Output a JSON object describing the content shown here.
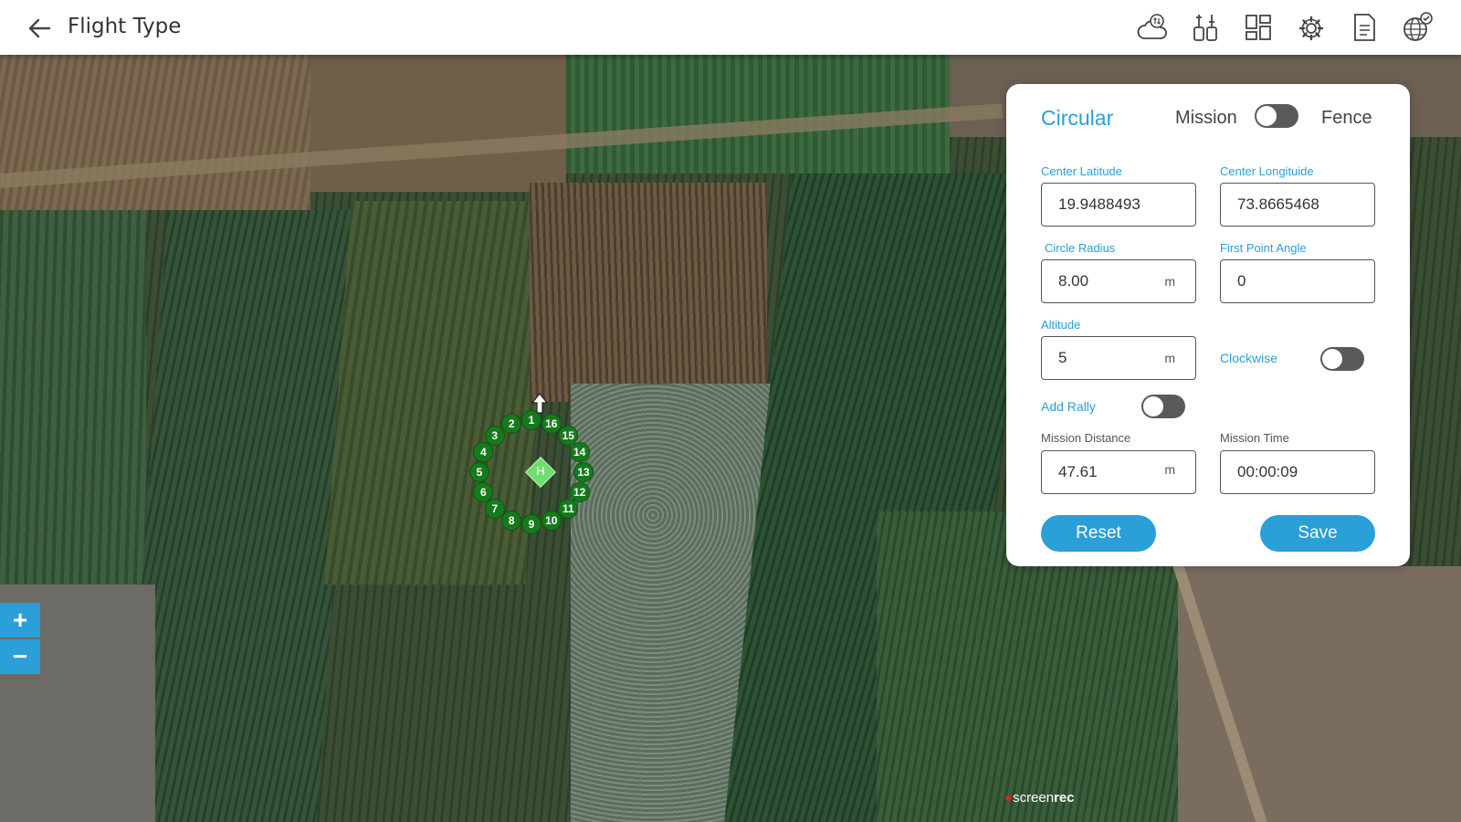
{
  "header": {
    "title": "Flight Type",
    "toolbar_icons": [
      "cloud-sync-icon",
      "controller-sliders-icon",
      "layout-dashboard-icon",
      "settings-gear-icon",
      "document-icon",
      "globe-check-icon"
    ]
  },
  "map": {
    "home_label": "H",
    "waypoints": [
      "1",
      "2",
      "3",
      "4",
      "5",
      "6",
      "7",
      "8",
      "9",
      "10",
      "11",
      "12",
      "13",
      "14",
      "15",
      "16"
    ],
    "zoom_in": "+",
    "zoom_out": "−",
    "watermark_prefix": "screen",
    "watermark_bold": "rec"
  },
  "panel": {
    "title": "Circular",
    "mode_left": "Mission",
    "mode_right": "Fence",
    "mode_toggle_on": false,
    "center_latitude": {
      "label": "Center Latitude",
      "value": "19.9488493"
    },
    "center_longitude": {
      "label": "Center Longituide",
      "value": "73.8665468"
    },
    "circle_radius": {
      "label": "Circle Radius",
      "value": "8.00",
      "unit": "m"
    },
    "first_point_angle": {
      "label": "First Point Angle",
      "value": "0"
    },
    "altitude": {
      "label": "Altitude",
      "value": "5",
      "unit": "m"
    },
    "clockwise": {
      "label": "Clockwise",
      "on": false
    },
    "add_rally": {
      "label": "Add Rally",
      "on": false
    },
    "mission_distance": {
      "label": "Mission Distance",
      "value": "47.61",
      "unit": "m"
    },
    "mission_time": {
      "label": "Mission Time",
      "value": "00:00:09"
    },
    "reset_label": "Reset",
    "save_label": "Save"
  },
  "colors": {
    "accent": "#2a9fd8",
    "waypoint": "#167a1d",
    "home": "#6fdc6f",
    "toggle_off": "#5a5a5a"
  }
}
